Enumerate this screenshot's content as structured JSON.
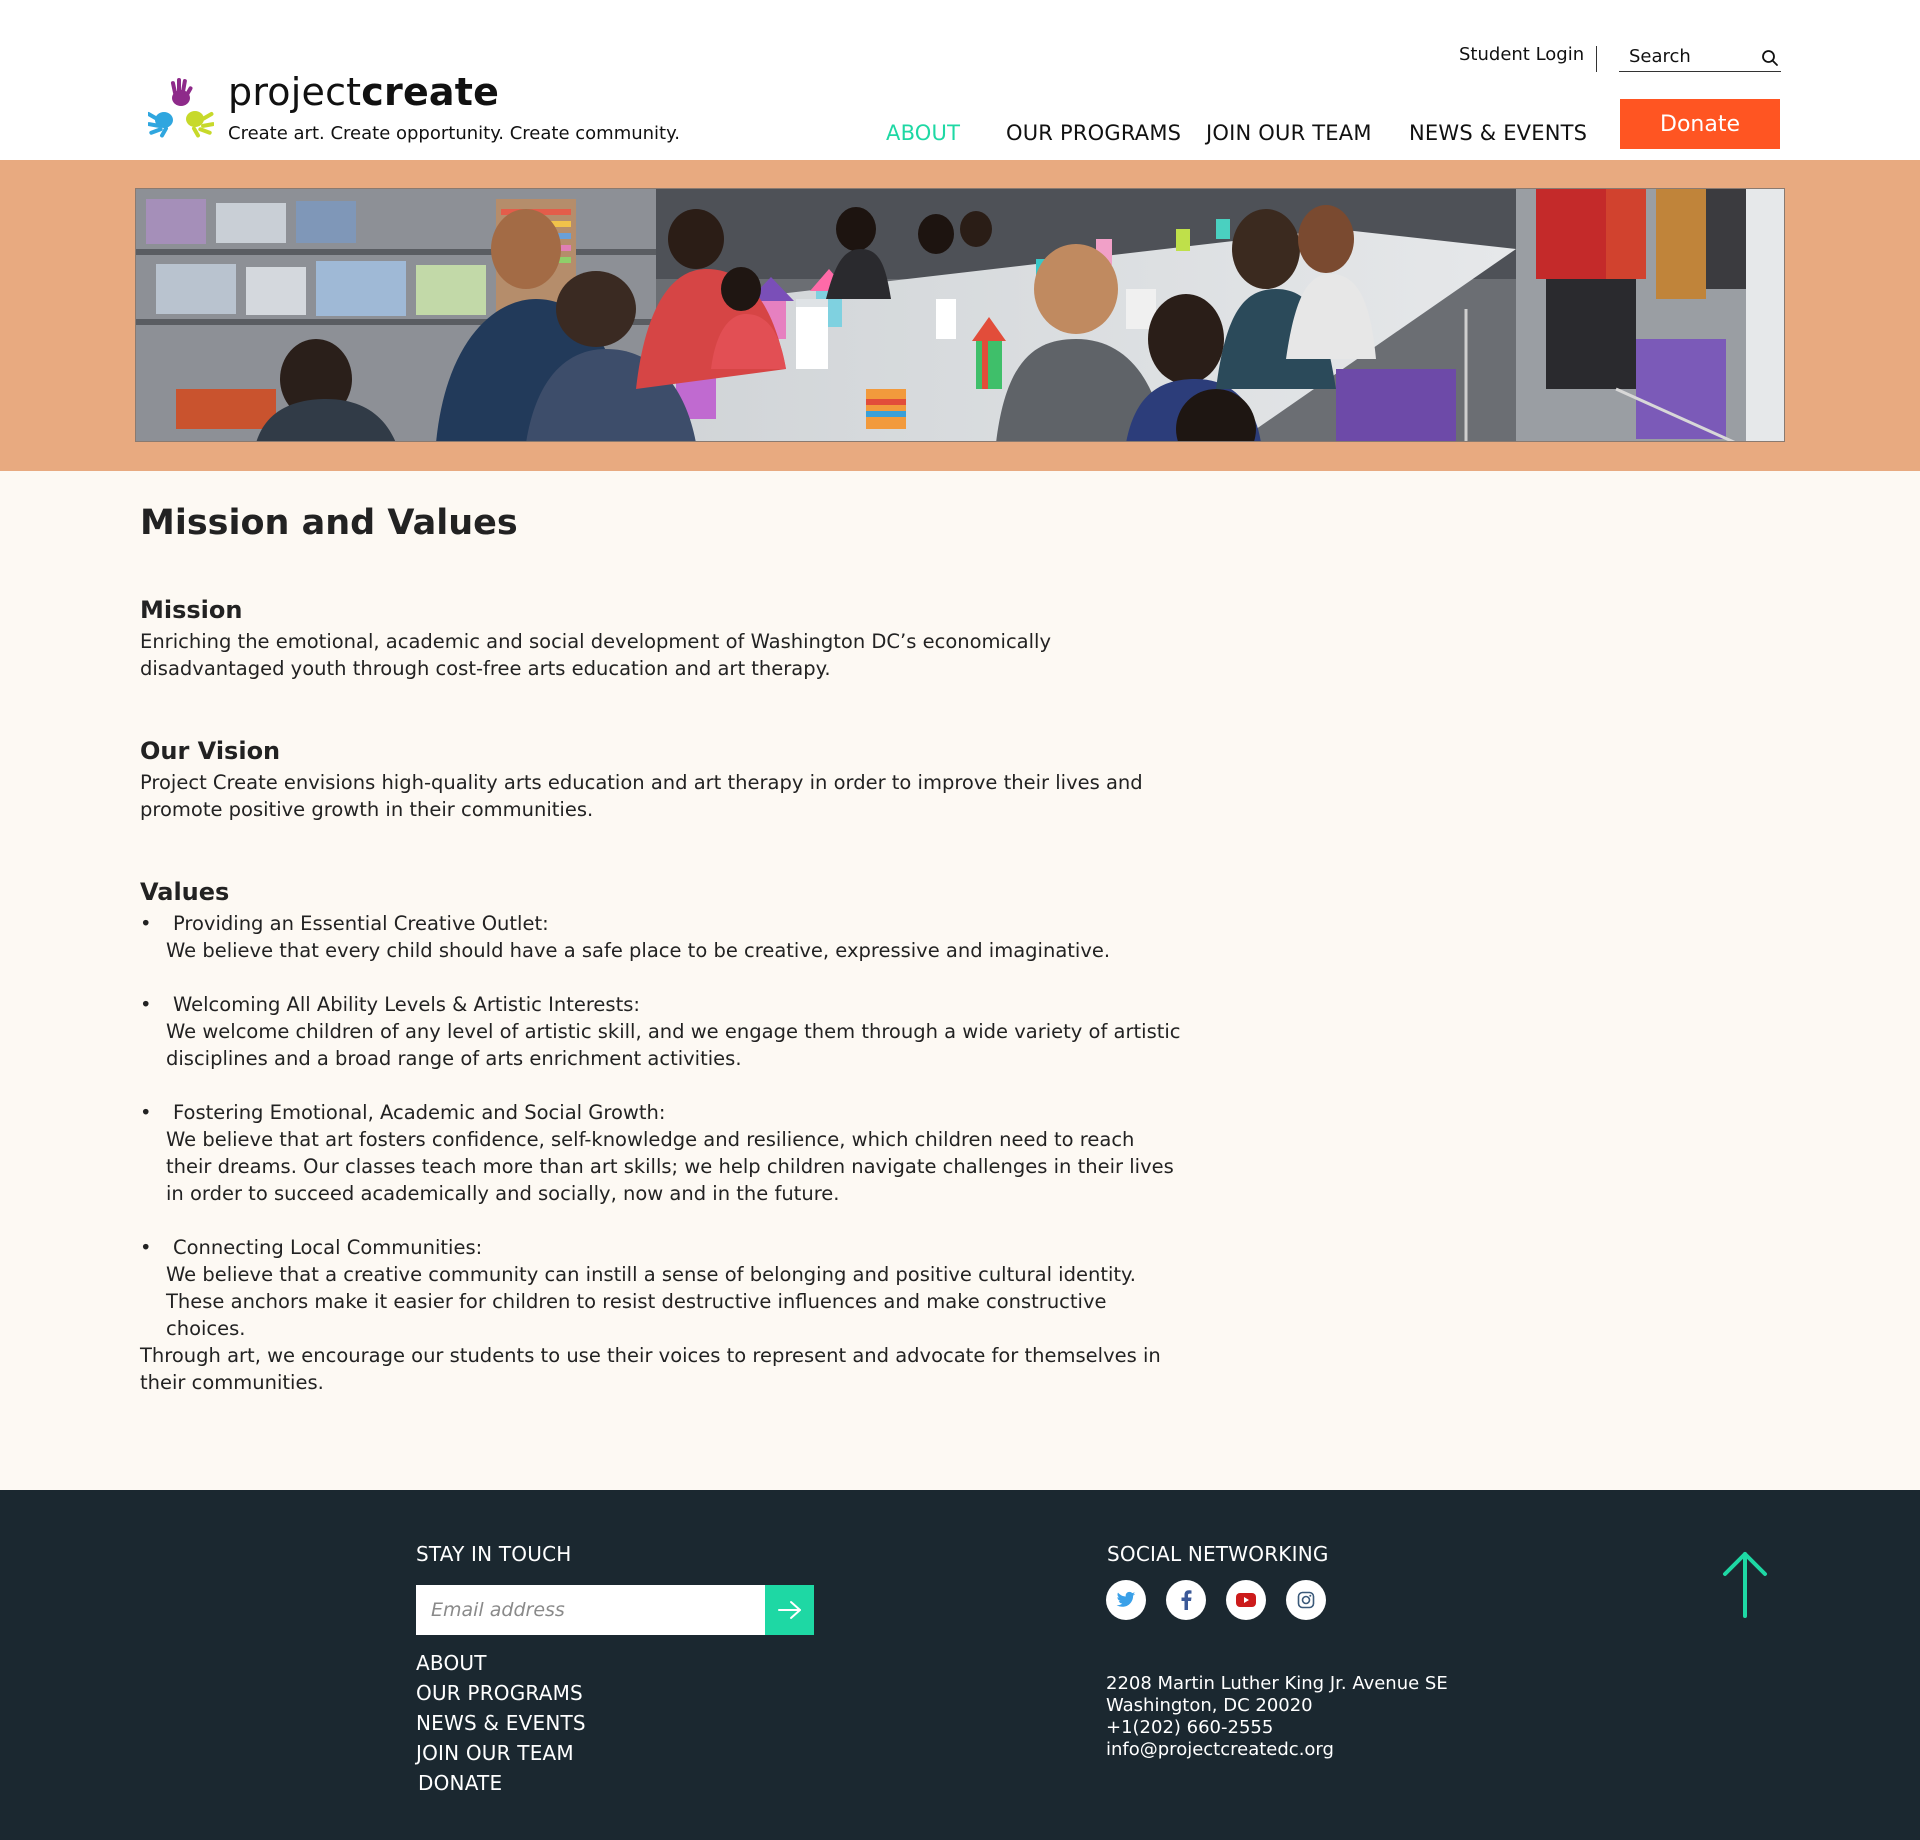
{
  "header": {
    "brand_light": "project",
    "brand_bold": "create",
    "tagline": "Create art. Create opportunity. Create community.",
    "student_login": "Student Login",
    "search_placeholder": "Search",
    "nav": [
      {
        "label": "ABOUT",
        "active": true
      },
      {
        "label": "OUR PROGRAMS",
        "active": false
      },
      {
        "label": "JOIN OUR TEAM",
        "active": false
      },
      {
        "label": "NEWS & EVENTS",
        "active": false
      }
    ],
    "donate_label": "Donate"
  },
  "colors": {
    "accent": "#1ed8a4",
    "donate": "#ff5522",
    "hero_band": "#e8aa80",
    "page_bg": "#fdf9f3",
    "footer_bg": "#1b2830"
  },
  "main": {
    "title": "Mission and Values",
    "mission": {
      "heading": "Mission",
      "text": "Enriching the emotional, academic and social development of Washington DC’s economically disadvantaged youth through cost-free arts education and art therapy."
    },
    "vision": {
      "heading": "Our Vision",
      "text": "Project Create envisions high-quality arts education and art therapy in order to improve their lives and promote positive growth in their communities."
    },
    "values": {
      "heading": "Values",
      "bullet": "•",
      "items": [
        {
          "title": "Providing an Essential Creative Outlet:",
          "desc": "We believe that every child should have a safe place to be creative, expressive and imaginative."
        },
        {
          "title": "Welcoming All Ability Levels & Artistic Interests:",
          "desc": "We welcome children of any level of artistic skill, and we engage them through a wide variety of artistic disciplines and a broad range of arts enrichment activities."
        },
        {
          "title": "Fostering Emotional, Academic and Social Growth:",
          "desc": "We believe that art fosters confidence, self-knowledge and resilience, which children need to reach their dreams. Our classes teach more than art skills; we help children navigate challenges in their lives in order to succeed academically and socially, now and in the future."
        },
        {
          "title": "Connecting Local Communities:",
          "desc_line1": "We believe that a creative community can instill a sense of belonging and positive cultural identity.",
          "desc_line2": "These anchors make it easier for children to resist destructive influences and make constructive choices."
        }
      ]
    },
    "closing": "Through art, we encourage our students to use their voices to represent and advocate for themselves in their communities."
  },
  "footer": {
    "stay_in_touch": "STAY IN TOUCH",
    "email_placeholder": "Email address",
    "links": [
      "ABOUT",
      "OUR PROGRAMS",
      "NEWS & EVENTS",
      "JOIN OUR TEAM",
      "DONATE"
    ],
    "social_heading": "SOCIAL NETWORKING",
    "social_icons": [
      "twitter-icon",
      "facebook-icon",
      "youtube-icon",
      "instagram-icon"
    ],
    "address_line1": "2208 Martin Luther King Jr. Avenue SE",
    "address_line2": "Washington, DC 20020",
    "phone": "+1(202) 660-2555",
    "email": "info@projectcreatedc.org"
  }
}
